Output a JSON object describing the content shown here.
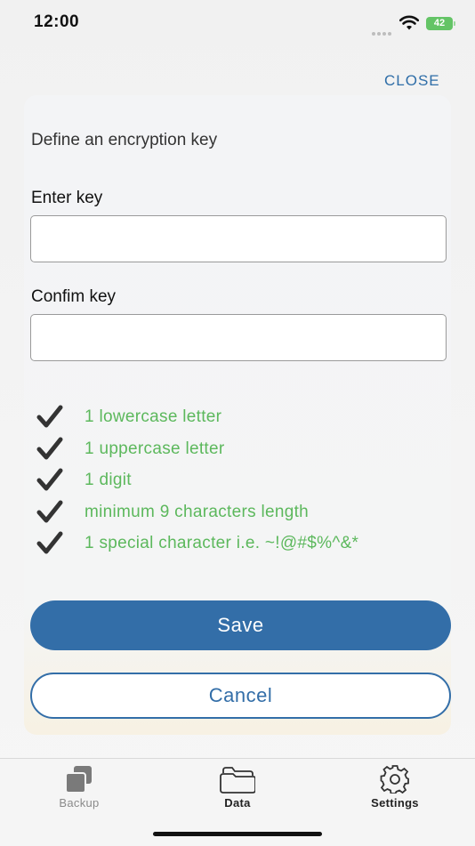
{
  "status_bar": {
    "time": "12:00",
    "battery": "42"
  },
  "header": {
    "close_label": "CLOSE"
  },
  "dialog": {
    "title": "Define an encryption key",
    "enter_key": {
      "label": "Enter key",
      "value": ""
    },
    "confirm_key": {
      "label": "Confim key",
      "value": ""
    },
    "requirements": [
      "1 lowercase letter",
      "1 uppercase letter",
      "1 digit",
      "minimum 9 characters length",
      "1 special character i.e. ~!@#$%^&*"
    ],
    "save_label": "Save",
    "cancel_label": "Cancel"
  },
  "tab_bar": {
    "items": [
      {
        "label": "Backup",
        "icon": "backup-icon",
        "active": false
      },
      {
        "label": "Data",
        "icon": "folder-icon",
        "active": true
      },
      {
        "label": "Settings",
        "icon": "gear-icon",
        "active": false
      }
    ]
  },
  "colors": {
    "accent": "#336ea8",
    "success": "#5cb85c",
    "battery": "#64c466"
  }
}
